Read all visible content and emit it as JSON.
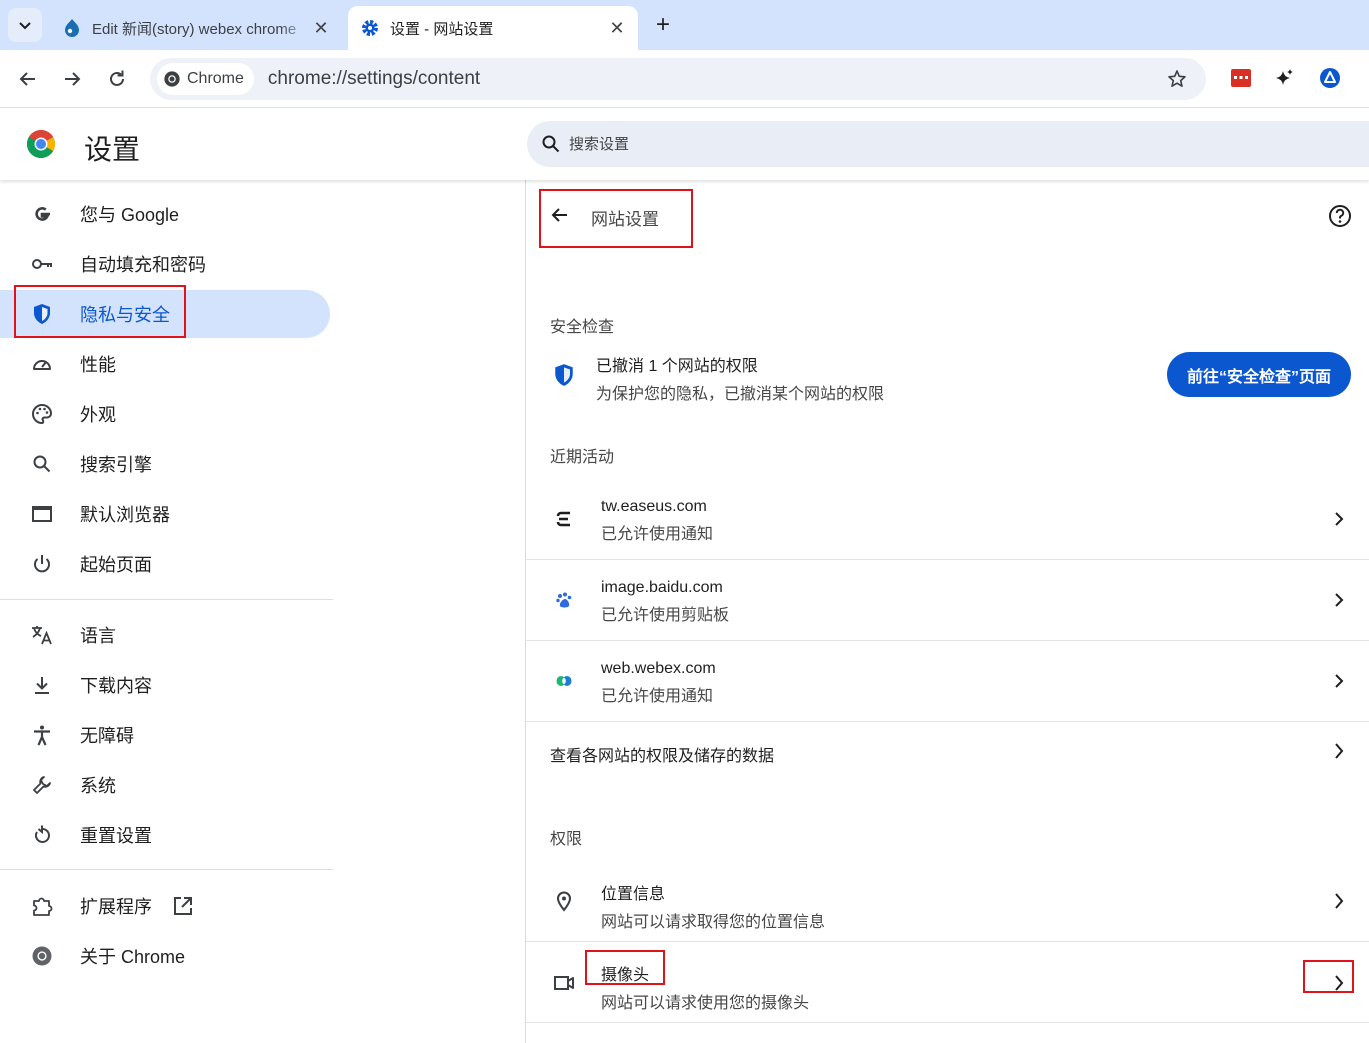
{
  "tabs": [
    {
      "title": "Edit 新闻(story) webex chrome",
      "close": "✕",
      "active": false
    },
    {
      "title": "设置 - 网站设置",
      "close": "✕",
      "active": true
    }
  ],
  "new_tab": "+",
  "omnibox": {
    "chip_label": "Chrome",
    "url": "chrome://settings/content"
  },
  "settings": {
    "title": "设置",
    "search_placeholder": "搜索设置"
  },
  "sidebar": {
    "items": [
      {
        "label": "您与 Google",
        "icon": "google-g-icon"
      },
      {
        "label": "自动填充和密码",
        "icon": "key-icon"
      },
      {
        "label": "隐私与安全",
        "icon": "shield-icon",
        "selected": true
      },
      {
        "label": "性能",
        "icon": "speedometer-icon"
      },
      {
        "label": "外观",
        "icon": "palette-icon"
      },
      {
        "label": "搜索引擎",
        "icon": "search-icon"
      },
      {
        "label": "默认浏览器",
        "icon": "browser-window-icon"
      },
      {
        "label": "起始页面",
        "icon": "power-icon"
      },
      {
        "label": "语言",
        "icon": "translate-icon"
      },
      {
        "label": "下载内容",
        "icon": "download-icon"
      },
      {
        "label": "无障碍",
        "icon": "accessibility-icon"
      },
      {
        "label": "系统",
        "icon": "wrench-icon"
      },
      {
        "label": "重置设置",
        "icon": "reset-icon"
      },
      {
        "label": "扩展程序",
        "icon": "puzzle-icon"
      },
      {
        "label": "关于 Chrome",
        "icon": "chrome-icon"
      }
    ]
  },
  "main": {
    "page_title": "网站设置",
    "safety_check": {
      "heading": "安全检查",
      "title": "已撤消 1 个网站的权限",
      "subtitle": "为保护您的隐私，已撤消某个网站的权限",
      "button": "前往“安全检查”页面"
    },
    "recent": {
      "heading": "近期活动",
      "items": [
        {
          "site": "tw.easeus.com",
          "status": "已允许使用通知"
        },
        {
          "site": "image.baidu.com",
          "status": "已允许使用剪贴板"
        },
        {
          "site": "web.webex.com",
          "status": "已允许使用通知"
        }
      ]
    },
    "view_all": "查看各网站的权限及储存的数据",
    "permissions": {
      "heading": "权限",
      "items": [
        {
          "title": "位置信息",
          "subtitle": "网站可以请求取得您的位置信息"
        },
        {
          "title": "摄像头",
          "subtitle": "网站可以请求使用您的摄像头"
        }
      ]
    }
  },
  "colors": {
    "accent": "#0b57d0",
    "selected_bg": "#d3e3fd",
    "highlight_box": "#e0121b",
    "tabstrip_bg": "#d3e3fd"
  }
}
